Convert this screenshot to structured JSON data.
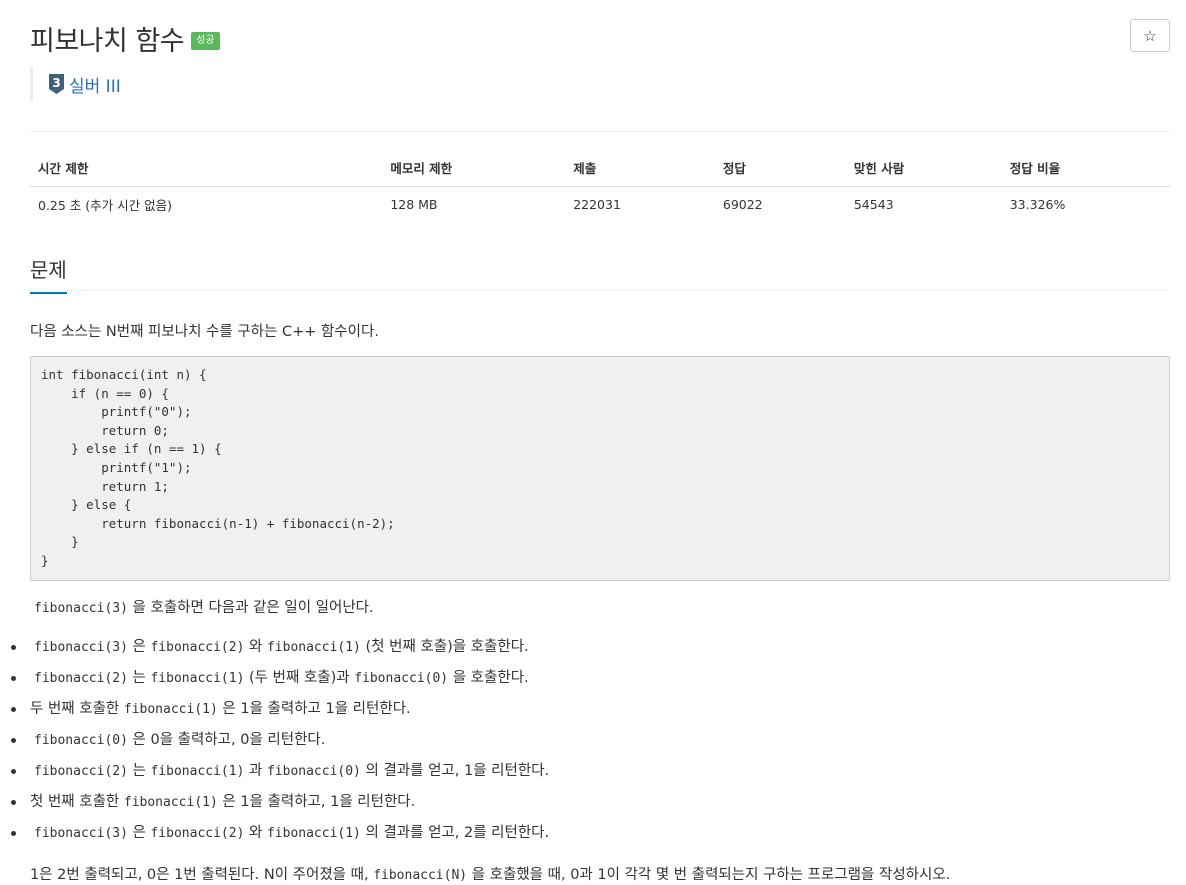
{
  "header": {
    "title": "피보나치 함수",
    "result_badge": "성공",
    "star_label": "☆",
    "tier": {
      "number": "3",
      "label": "실버 III"
    }
  },
  "info_table": {
    "headers": [
      "시간 제한",
      "메모리 제한",
      "제출",
      "정답",
      "맞힌 사람",
      "정답 비율"
    ],
    "values": [
      "0.25 초 (추가 시간 없음)",
      "128 MB",
      "222031",
      "69022",
      "54543",
      "33.326%"
    ]
  },
  "section": {
    "title": "문제"
  },
  "intro": "다음 소스는 N번째 피보나치 수를 구하는 C++ 함수이다.",
  "code": "int fibonacci(int n) {\n    if (n == 0) {\n        printf(\"0\");\n        return 0;\n    } else if (n == 1) {\n        printf(\"1\");\n        return 1;\n    } else {\n        return fibonacci(n-1) + fibonacci(n-2);\n    }\n}",
  "call_line": {
    "code": "fibonacci(3)",
    "text": " 을 호출하면 다음과 같은 일이 일어난다."
  },
  "steps": [
    {
      "c1": "fibonacci(3)",
      "t1": " 은 ",
      "c2": "fibonacci(2)",
      "t2": " 와 ",
      "c3": "fibonacci(1)",
      "t3": " (첫 번째 호출)을 호출한다."
    },
    {
      "c1": "fibonacci(2)",
      "t1": " 는 ",
      "c2": "fibonacci(1)",
      "t2": " (두 번째 호출)과 ",
      "c3": "fibonacci(0)",
      "t3": " 을 호출한다."
    },
    {
      "p": "두 번째 호출한 ",
      "c1": "fibonacci(1)",
      "t1": " 은 1을 출력하고 1을 리턴한다."
    },
    {
      "c1": "fibonacci(0)",
      "t1": " 은 0을 출력하고, 0을 리턴한다."
    },
    {
      "c1": "fibonacci(2)",
      "t1": " 는 ",
      "c2": "fibonacci(1)",
      "t2": " 과 ",
      "c3": "fibonacci(0)",
      "t3": " 의 결과를 얻고, 1을 리턴한다."
    },
    {
      "p": "첫 번째 호출한 ",
      "c1": "fibonacci(1)",
      "t1": " 은 1을 출력하고, 1을 리턴한다."
    },
    {
      "c1": "fibonacci(3)",
      "t1": " 은 ",
      "c2": "fibonacci(2)",
      "t2": " 와 ",
      "c3": "fibonacci(1)",
      "t3": " 의 결과를 얻고, 2를 리턴한다."
    }
  ],
  "summary": {
    "t1": "1은 2번 출력되고, 0은 1번 출력된다. N이 주어졌을 때, ",
    "c1": "fibonacci(N)",
    "t2": " 을 호출했을 때, 0과 1이 각각 몇 번 출력되는지 구하는 프로그램을 작성하시오."
  },
  "colors": {
    "badge": "#5cb85c",
    "tier": "#2a6ebb",
    "heading_underline": "#0076c0"
  }
}
